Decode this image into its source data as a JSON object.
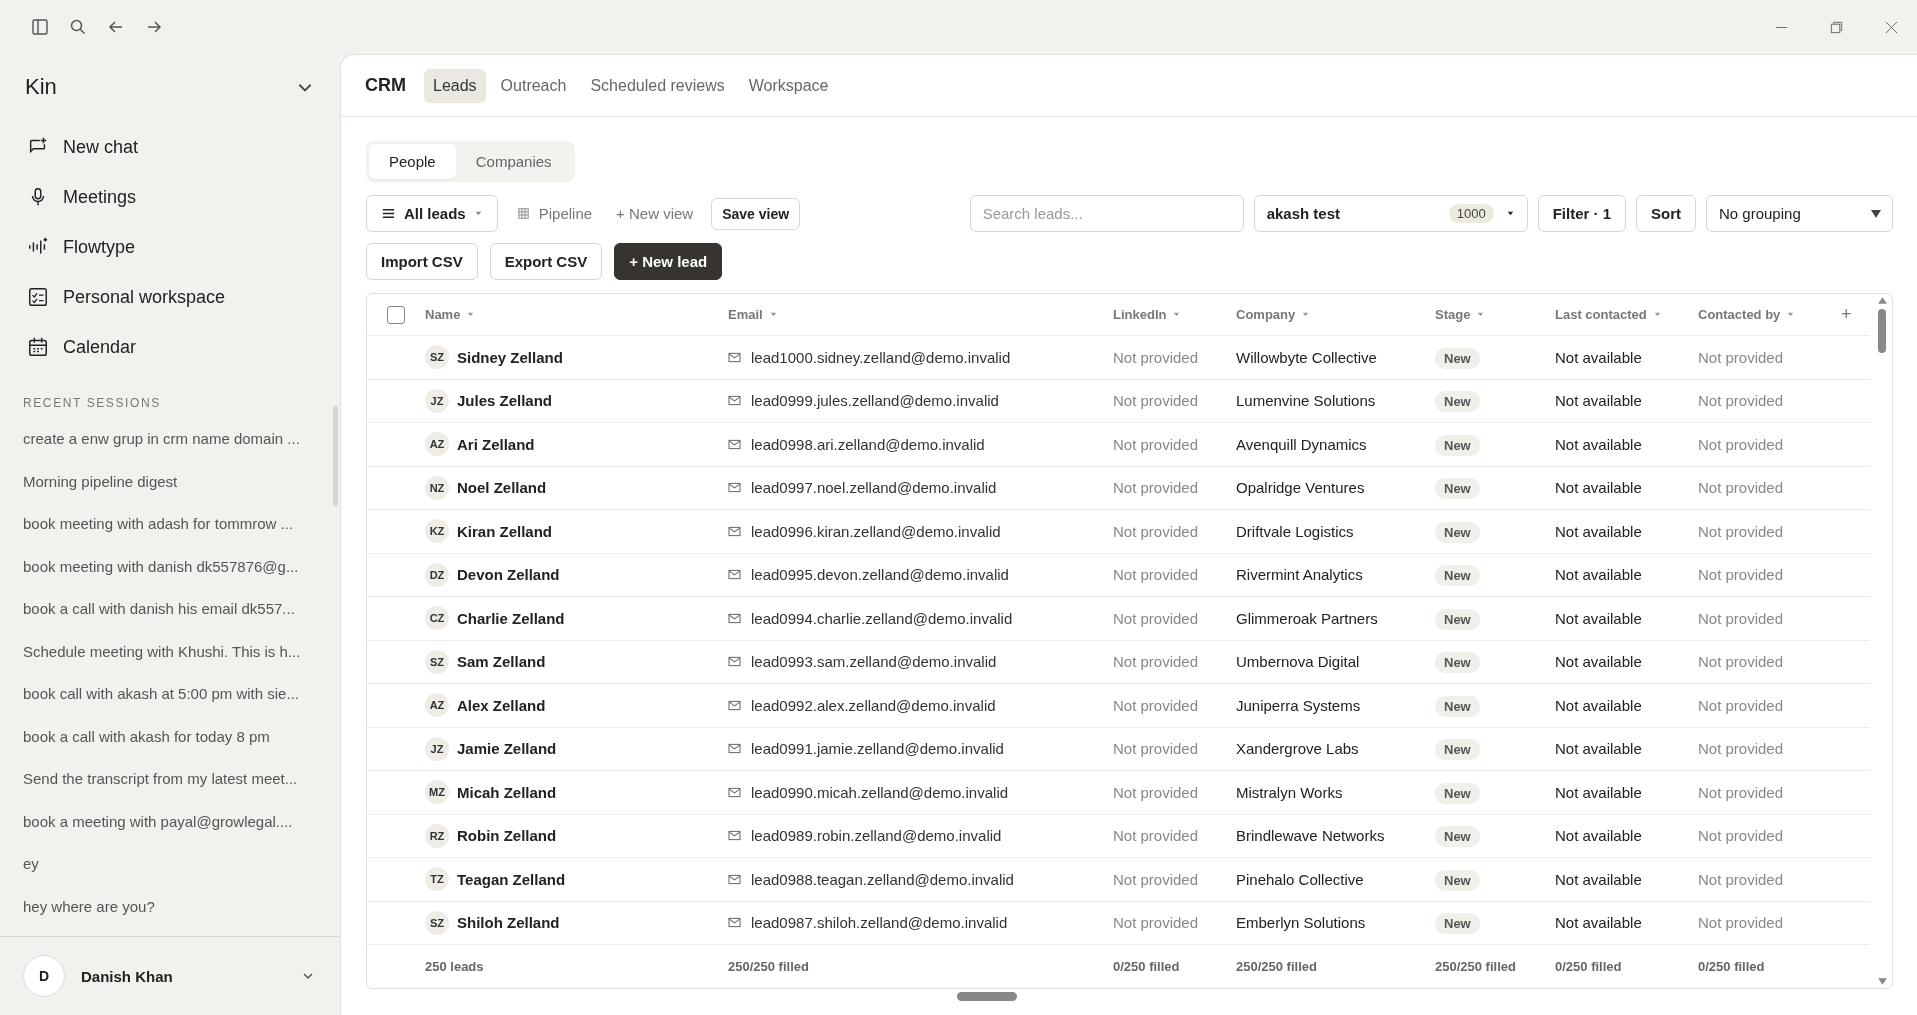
{
  "workspace": {
    "name": "Kin"
  },
  "nav": [
    {
      "label": "New chat",
      "kind": "chat"
    },
    {
      "label": "Meetings",
      "kind": "mic"
    },
    {
      "label": "Flowtype",
      "kind": "wave"
    },
    {
      "label": "Personal workspace",
      "kind": "board"
    },
    {
      "label": "Calendar",
      "kind": "calendar"
    }
  ],
  "recent_sessions": {
    "title": "RECENT SESSIONS",
    "items": [
      "create a enw grup in crm name domain ...",
      "Morning pipeline digest",
      "book meeting with adash for tommrow ...",
      "book meeting with danish dk557876@g...",
      "book a call with danish his email dk557...",
      "Schedule meeting with Khushi. This is h...",
      "book call with akash at 5:00 pm with sie...",
      "book a call with akash for today 8 pm",
      "Send the transcript from my latest meet...",
      "book a meeting with payal@growlegal....",
      "ey",
      "hey where are you?"
    ]
  },
  "user": {
    "initial": "D",
    "name": "Danish Khan"
  },
  "header": {
    "title": "CRM",
    "tabs": [
      {
        "label": "Leads",
        "selected": true
      },
      {
        "label": "Outreach",
        "selected": false
      },
      {
        "label": "Scheduled reviews",
        "selected": false
      },
      {
        "label": "Workspace",
        "selected": false
      }
    ]
  },
  "segments": [
    {
      "label": "People",
      "selected": true
    },
    {
      "label": "Companies",
      "selected": false
    }
  ],
  "views": {
    "all_leads": "All leads",
    "pipeline": "Pipeline",
    "new_view": "+ New view",
    "save_view": "Save view"
  },
  "search": {
    "placeholder": "Search leads..."
  },
  "list_select": {
    "value": "akash test",
    "count": "1000"
  },
  "filter": "Filter · 1",
  "sort": "Sort",
  "grouping": "No grouping",
  "actions": {
    "import": "Import CSV",
    "export": "Export CSV",
    "new_lead": "+ New lead"
  },
  "table": {
    "select_all": {
      "checked": false
    },
    "columns": [
      "Name",
      "Email",
      "LinkedIn",
      "Company",
      "Stage",
      "Last contacted",
      "Contacted by"
    ],
    "add_column": "+",
    "rows": [
      {
        "initials": "SZ",
        "name": "Sidney Zelland",
        "email": "lead1000.sidney.zelland@demo.invalid",
        "linkedin": "Not provided",
        "company": "Willowbyte Collective",
        "stage": "New",
        "last_contacted": "Not available",
        "contacted_by": "Not provided"
      },
      {
        "initials": "JZ",
        "name": "Jules Zelland",
        "email": "lead0999.jules.zelland@demo.invalid",
        "linkedin": "Not provided",
        "company": "Lumenvine Solutions",
        "stage": "New",
        "last_contacted": "Not available",
        "contacted_by": "Not provided"
      },
      {
        "initials": "AZ",
        "name": "Ari Zelland",
        "email": "lead0998.ari.zelland@demo.invalid",
        "linkedin": "Not provided",
        "company": "Avenquill Dynamics",
        "stage": "New",
        "last_contacted": "Not available",
        "contacted_by": "Not provided"
      },
      {
        "initials": "NZ",
        "name": "Noel Zelland",
        "email": "lead0997.noel.zelland@demo.invalid",
        "linkedin": "Not provided",
        "company": "Opalridge Ventures",
        "stage": "New",
        "last_contacted": "Not available",
        "contacted_by": "Not provided"
      },
      {
        "initials": "KZ",
        "name": "Kiran Zelland",
        "email": "lead0996.kiran.zelland@demo.invalid",
        "linkedin": "Not provided",
        "company": "Driftvale Logistics",
        "stage": "New",
        "last_contacted": "Not available",
        "contacted_by": "Not provided"
      },
      {
        "initials": "DZ",
        "name": "Devon Zelland",
        "email": "lead0995.devon.zelland@demo.invalid",
        "linkedin": "Not provided",
        "company": "Rivermint Analytics",
        "stage": "New",
        "last_contacted": "Not available",
        "contacted_by": "Not provided"
      },
      {
        "initials": "CZ",
        "name": "Charlie Zelland",
        "email": "lead0994.charlie.zelland@demo.invalid",
        "linkedin": "Not provided",
        "company": "Glimmeroak Partners",
        "stage": "New",
        "last_contacted": "Not available",
        "contacted_by": "Not provided"
      },
      {
        "initials": "SZ",
        "name": "Sam Zelland",
        "email": "lead0993.sam.zelland@demo.invalid",
        "linkedin": "Not provided",
        "company": "Umbernova Digital",
        "stage": "New",
        "last_contacted": "Not available",
        "contacted_by": "Not provided"
      },
      {
        "initials": "AZ",
        "name": "Alex Zelland",
        "email": "lead0992.alex.zelland@demo.invalid",
        "linkedin": "Not provided",
        "company": "Juniperra Systems",
        "stage": "New",
        "last_contacted": "Not available",
        "contacted_by": "Not provided"
      },
      {
        "initials": "JZ",
        "name": "Jamie Zelland",
        "email": "lead0991.jamie.zelland@demo.invalid",
        "linkedin": "Not provided",
        "company": "Xandergrove Labs",
        "stage": "New",
        "last_contacted": "Not available",
        "contacted_by": "Not provided"
      },
      {
        "initials": "MZ",
        "name": "Micah Zelland",
        "email": "lead0990.micah.zelland@demo.invalid",
        "linkedin": "Not provided",
        "company": "Mistralyn Works",
        "stage": "New",
        "last_contacted": "Not available",
        "contacted_by": "Not provided"
      },
      {
        "initials": "RZ",
        "name": "Robin Zelland",
        "email": "lead0989.robin.zelland@demo.invalid",
        "linkedin": "Not provided",
        "company": "Brindlewave Networks",
        "stage": "New",
        "last_contacted": "Not available",
        "contacted_by": "Not provided"
      },
      {
        "initials": "TZ",
        "name": "Teagan Zelland",
        "email": "lead0988.teagan.zelland@demo.invalid",
        "linkedin": "Not provided",
        "company": "Pinehalo Collective",
        "stage": "New",
        "last_contacted": "Not available",
        "contacted_by": "Not provided"
      },
      {
        "initials": "SZ",
        "name": "Shiloh Zelland",
        "email": "lead0987.shiloh.zelland@demo.invalid",
        "linkedin": "Not provided",
        "company": "Emberlyn Solutions",
        "stage": "New",
        "last_contacted": "Not available",
        "contacted_by": "Not provided"
      }
    ],
    "footer": [
      "250 leads",
      "250/250 filled",
      "0/250 filled",
      "250/250 filled",
      "250/250 filled",
      "0/250 filled",
      "0/250 filled"
    ]
  }
}
